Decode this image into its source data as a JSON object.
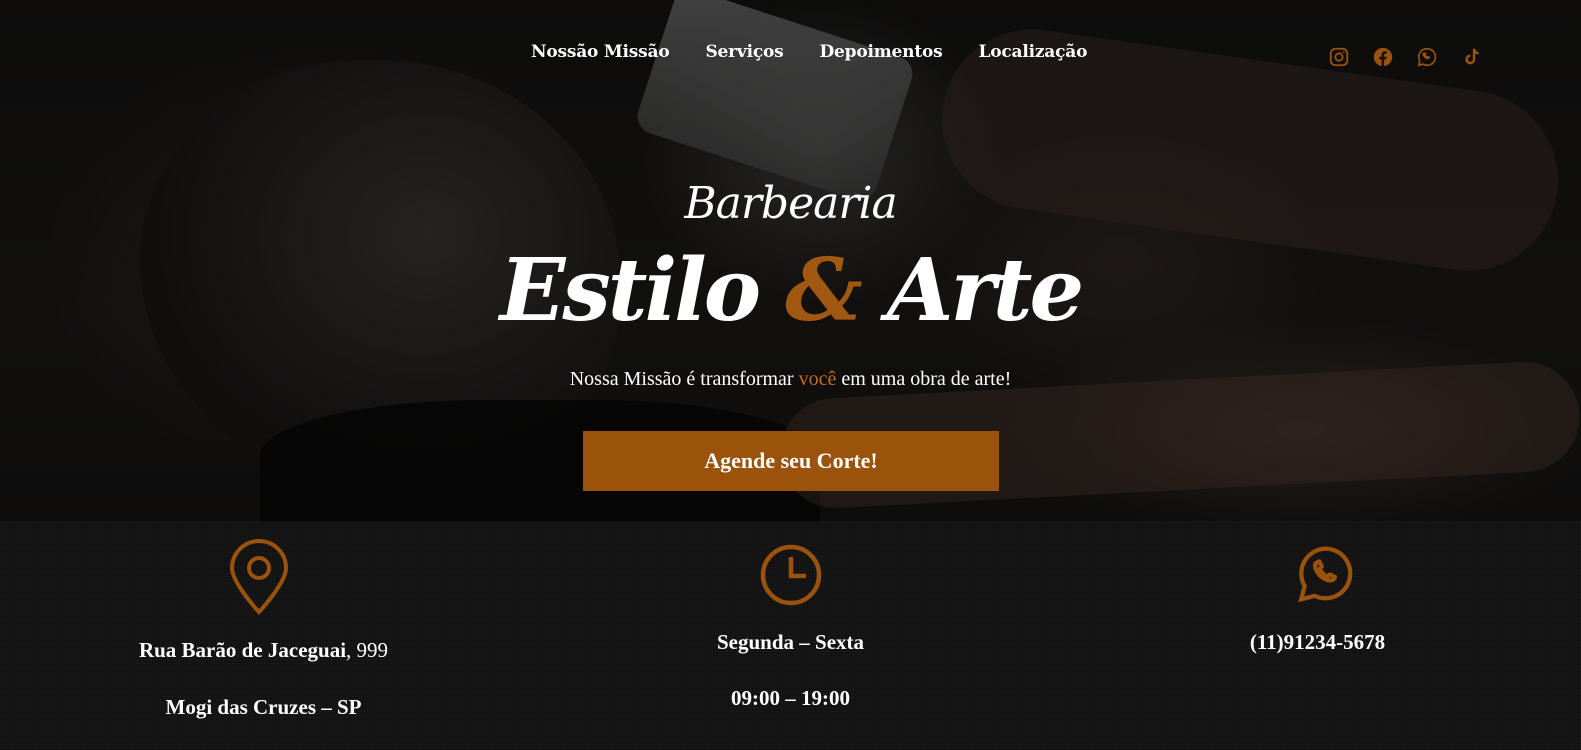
{
  "nav": {
    "items": [
      "Nossão Missão",
      "Serviços",
      "Depoimentos",
      "Localização"
    ]
  },
  "social": {
    "icons": [
      "instagram-icon",
      "facebook-icon",
      "whatsapp-icon",
      "tiktok-icon"
    ],
    "color": "#9b520b"
  },
  "hero": {
    "brand_small": "Barbearia",
    "brand_word1": "Estilo",
    "brand_amp": "&",
    "brand_word2": "Arte",
    "tagline_before": "Nossa Missão é transformar ",
    "tagline_highlight": "você",
    "tagline_after": " em uma obra de arte!",
    "cta_label": "Agende seu Corte!"
  },
  "info": {
    "address_bold": "Rua Barão de Jaceguai",
    "address_rest": ", 999",
    "city": "Mogi das Cruzes – SP",
    "days": "Segunda – Sexta",
    "hours": "09:00 – 19:00",
    "phone": "(11)91234-5678",
    "icons": [
      "location-pin-icon",
      "clock-icon",
      "whatsapp-icon"
    ]
  },
  "colors": {
    "accent": "#9b520b",
    "highlight": "#c06a1e",
    "background": "#121212"
  }
}
